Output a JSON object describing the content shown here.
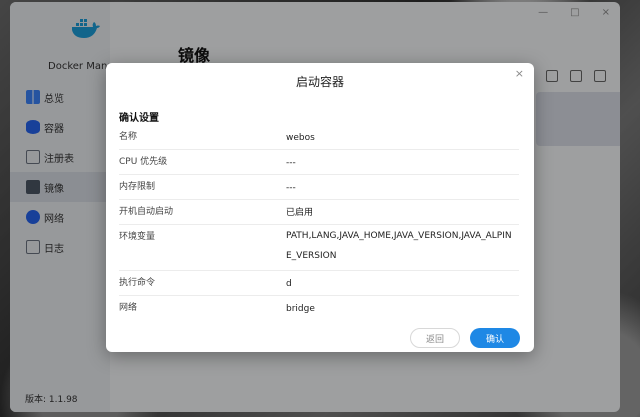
{
  "app": {
    "name": "Docker Manager",
    "version_label": "版本: 1.1.98",
    "page_title": "镜像",
    "window_controls": [
      "×",
      "□",
      "—"
    ]
  },
  "sidebar": {
    "items": [
      {
        "label": "总览",
        "icon": "overview-icon",
        "color": "#3b82f6"
      },
      {
        "label": "容器",
        "icon": "container-icon",
        "color": "#2563eb"
      },
      {
        "label": "注册表",
        "icon": "registry-icon",
        "color": "#6b7280"
      },
      {
        "label": "镜像",
        "icon": "image-icon",
        "color": "#4b5563",
        "active": true
      },
      {
        "label": "网络",
        "icon": "network-icon",
        "color": "#2563eb"
      },
      {
        "label": "日志",
        "icon": "log-icon",
        "color": "#6b7280"
      }
    ]
  },
  "toolbar": {
    "icons": [
      "edit-icon",
      "export-icon",
      "delete-icon"
    ]
  },
  "dialog": {
    "title": "启动容器",
    "close": "×",
    "section": "确认设置",
    "rows": [
      {
        "key": "名称",
        "value": "webos"
      },
      {
        "key": "CPU 优先级",
        "value": "---"
      },
      {
        "key": "内存限制",
        "value": "---"
      },
      {
        "key": "开机自动启动",
        "value": "已启用"
      },
      {
        "key": "环境变量",
        "value": "PATH,LANG,JAVA_HOME,JAVA_VERSION,JAVA_ALPINE_VERSION"
      },
      {
        "key": "执行命令",
        "value": "d"
      },
      {
        "key": "网络",
        "value": "bridge"
      }
    ],
    "back_label": "返回",
    "confirm_label": "确认"
  }
}
